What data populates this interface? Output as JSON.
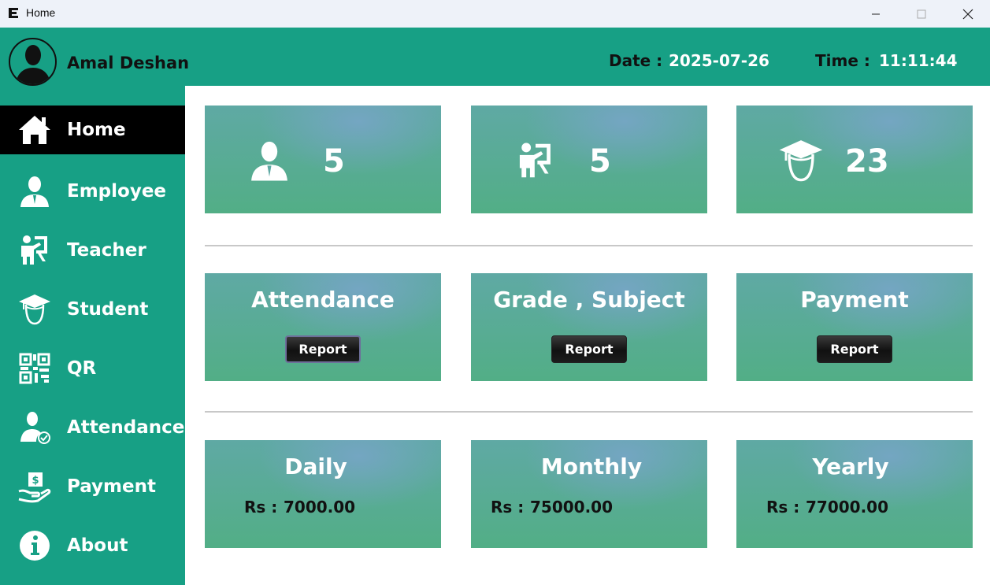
{
  "window": {
    "title": "Home"
  },
  "header": {
    "user_name": "Amal Deshan",
    "date_label": "Date :",
    "date_value": "2025-07-26",
    "time_label": "Time :",
    "time_value": "11:11:44",
    "background_color": "#17a085"
  },
  "sidebar": {
    "items": [
      {
        "label": "Home",
        "icon": "home-icon",
        "active": true
      },
      {
        "label": "Employee",
        "icon": "employee-icon",
        "active": false
      },
      {
        "label": "Teacher",
        "icon": "teacher-icon",
        "active": false
      },
      {
        "label": "Student",
        "icon": "student-icon",
        "active": false
      },
      {
        "label": "QR",
        "icon": "qr-code-icon",
        "active": false
      },
      {
        "label": "Attendance",
        "icon": "attendance-icon",
        "active": false
      },
      {
        "label": "Payment",
        "icon": "payment-icon",
        "active": false
      },
      {
        "label": "About",
        "icon": "info-icon",
        "active": false
      }
    ]
  },
  "stats": {
    "employees": {
      "value": "5",
      "icon": "employee-icon"
    },
    "teachers": {
      "value": "5",
      "icon": "teacher-icon"
    },
    "students": {
      "value": "23",
      "icon": "student-icon"
    }
  },
  "reports": {
    "attendance": {
      "title": "Attendance",
      "button": "Report"
    },
    "grade_subject": {
      "title": "Grade , Subject",
      "button": "Report"
    },
    "payment": {
      "title": "Payment",
      "button": "Report"
    }
  },
  "income": {
    "daily": {
      "title": "Daily",
      "currency_label": "Rs :",
      "amount": "7000.00"
    },
    "monthly": {
      "title": "Monthly",
      "currency_label": "Rs :",
      "amount": "75000.00"
    },
    "yearly": {
      "title": "Yearly",
      "currency_label": "Rs :",
      "amount": "77000.00"
    }
  },
  "colors": {
    "accent": "#17a085",
    "active_nav": "#000000",
    "card_green": "#52ae86",
    "card_blue_tint": "#78a5c8"
  }
}
